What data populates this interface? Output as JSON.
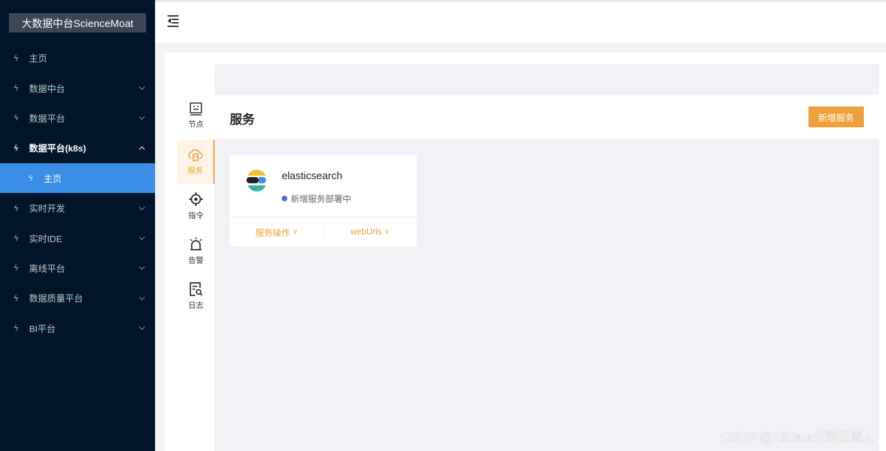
{
  "app": {
    "logo": "大数据中台ScienceMoat"
  },
  "sidebar": {
    "items": [
      {
        "label": "主页"
      },
      {
        "label": "数据中台"
      },
      {
        "label": "数据平台"
      },
      {
        "label": "数据平台(k8s)"
      },
      {
        "label": "主页"
      },
      {
        "label": "实时开发"
      },
      {
        "label": "实时IDE"
      },
      {
        "label": "离线平台"
      },
      {
        "label": "数据质量平台"
      },
      {
        "label": "BI平台"
      }
    ]
  },
  "tabs": [
    {
      "label": "节点",
      "icon": "node-icon"
    },
    {
      "label": "服务",
      "icon": "service-cloud-icon"
    },
    {
      "label": "指令",
      "icon": "target-icon"
    },
    {
      "label": "告警",
      "icon": "alarm-icon"
    },
    {
      "label": "日志",
      "icon": "log-search-icon"
    }
  ],
  "panel": {
    "title": "服务",
    "add_button": "新增服务"
  },
  "service_card": {
    "name": "elasticsearch",
    "status": "新增服务部署中",
    "status_color": "#3a72f0",
    "action_label": "服务操作",
    "urls_label": "webUrls"
  },
  "watermark": "CSDN @AllData公司负责人",
  "colors": {
    "accent": "#f0a03a",
    "sidebar_bg": "#001529",
    "active_menu": "#3a8ee6"
  }
}
